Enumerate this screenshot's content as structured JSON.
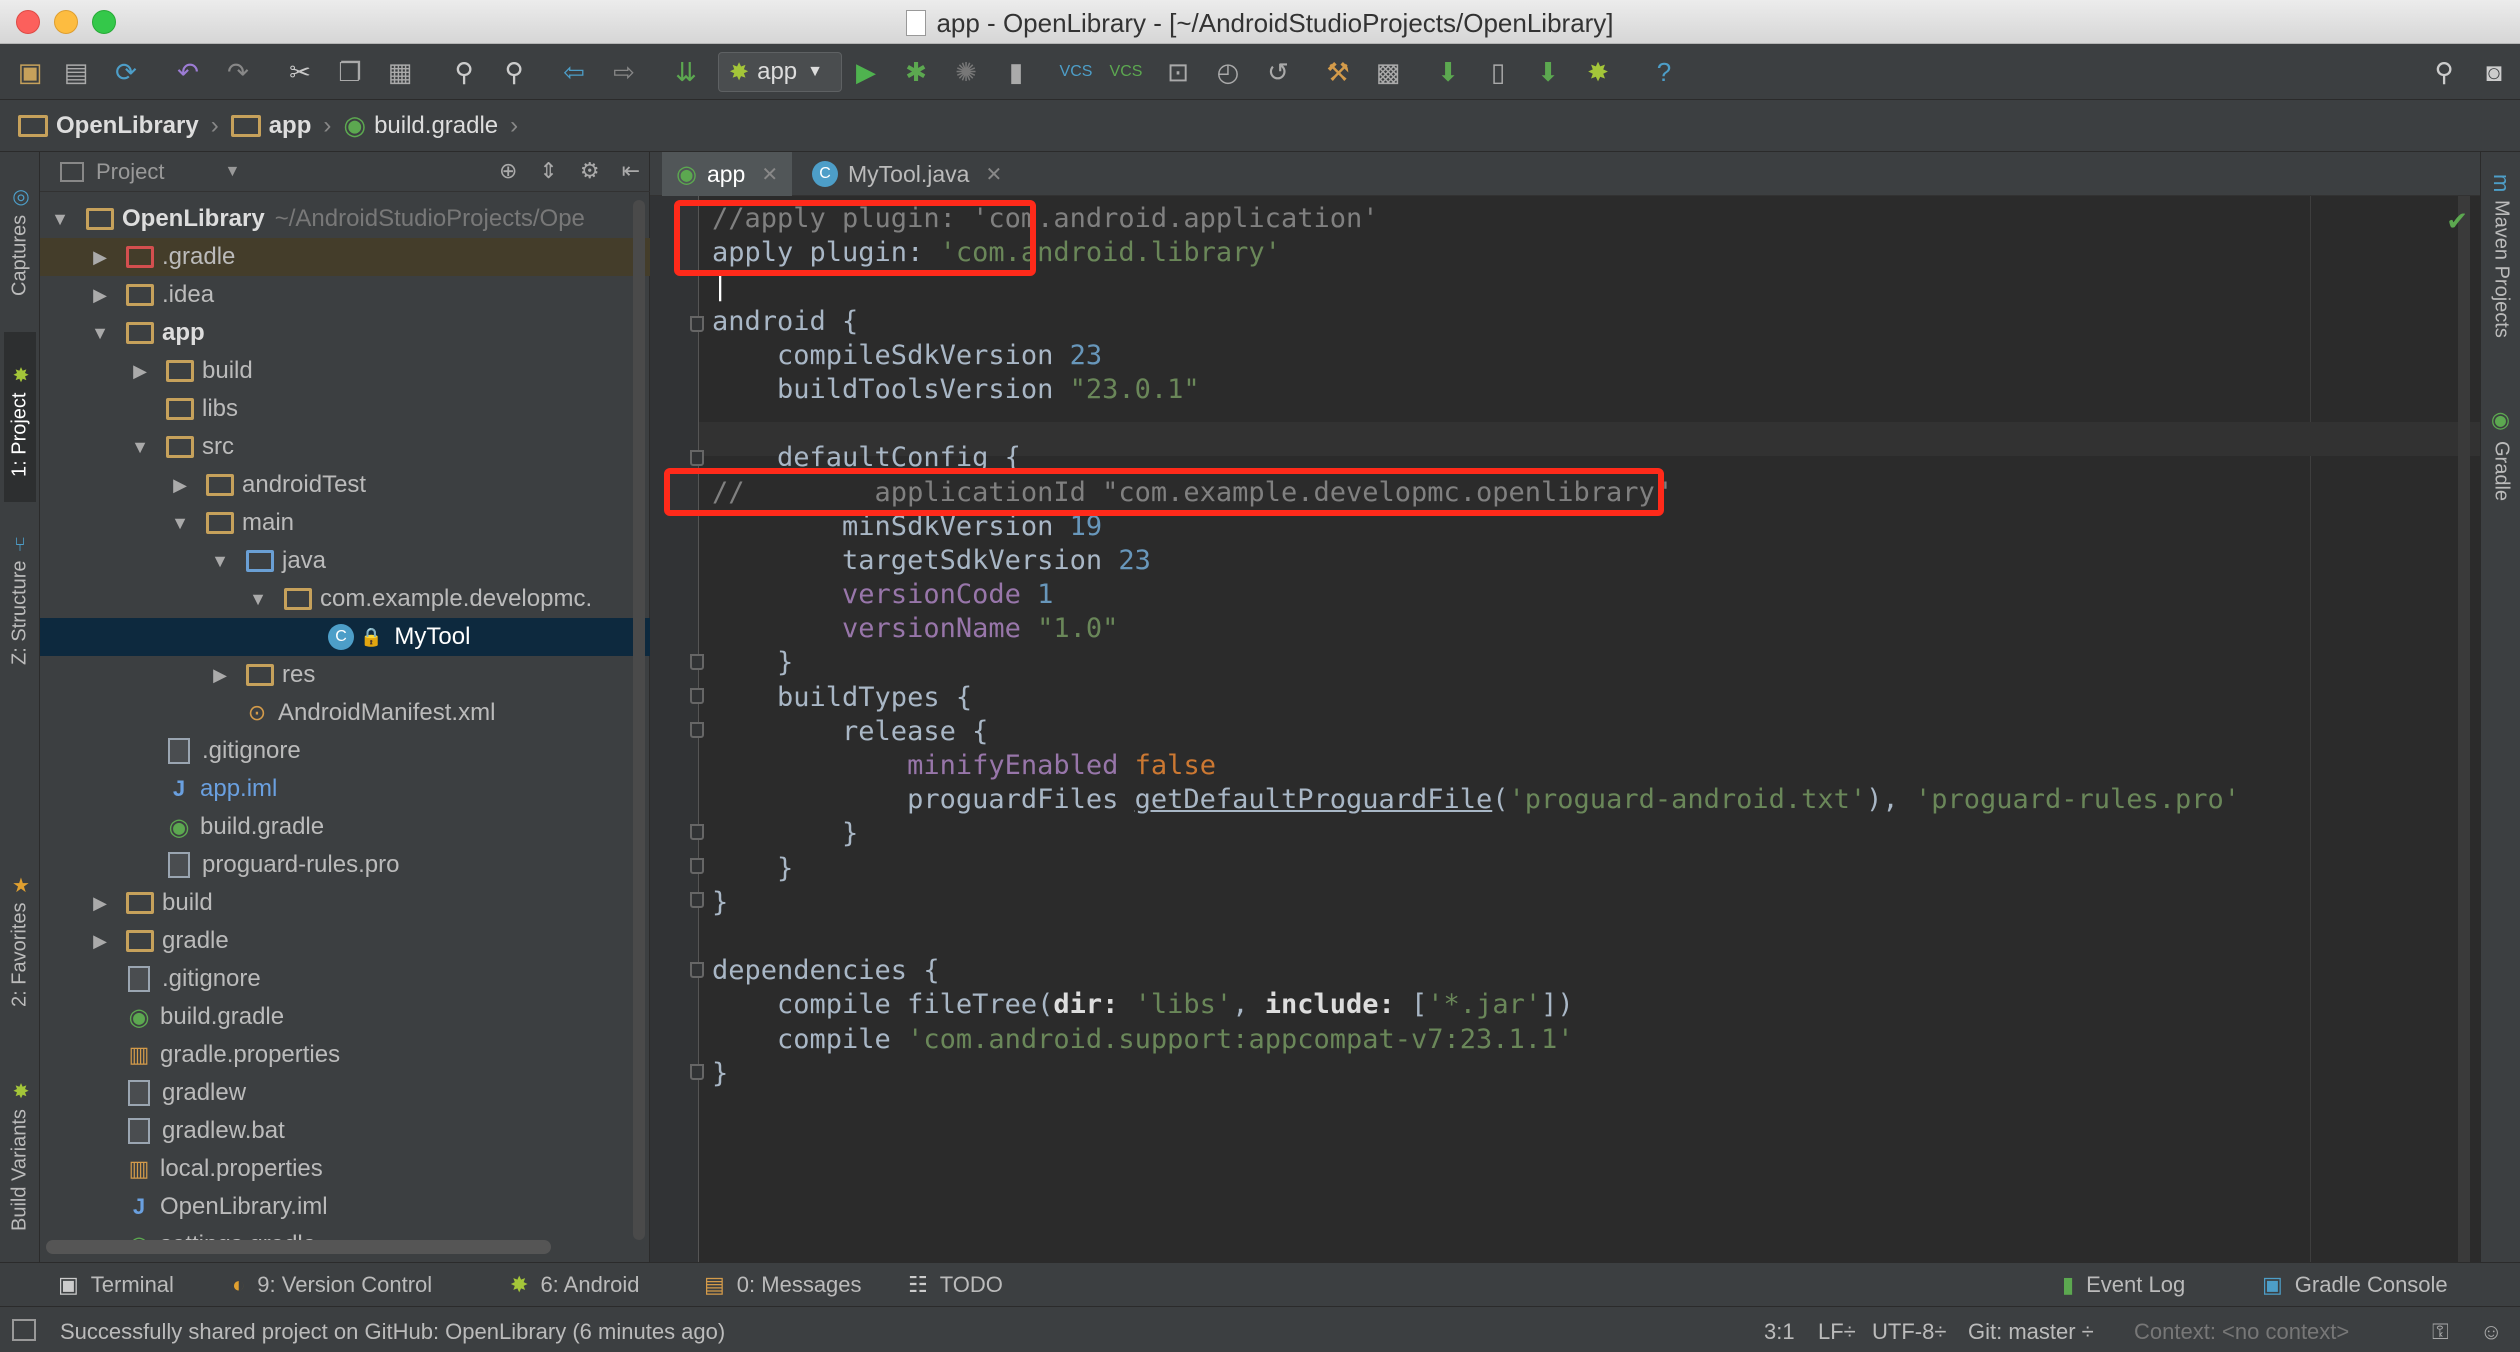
{
  "window": {
    "title": "app - OpenLibrary - [~/AndroidStudioProjects/OpenLibrary]"
  },
  "toolbar": {
    "run_config": "app"
  },
  "breadcrumb": [
    "OpenLibrary",
    "app",
    "build.gradle"
  ],
  "left_strip": [
    "1: Project",
    "Captures",
    "Z: Structure",
    "2: Favorites",
    "Build Variants"
  ],
  "right_strip": [
    "Maven Projects",
    "Gradle"
  ],
  "project_panel": {
    "header": "Project",
    "root_name": "OpenLibrary",
    "root_path": "~/AndroidStudioProjects/Ope",
    "items": [
      ".gradle",
      ".idea",
      "app",
      "build",
      "libs",
      "src",
      "androidTest",
      "main",
      "java",
      "com.example.developmc.",
      "MyTool",
      "res",
      "AndroidManifest.xml",
      ".gitignore",
      "app.iml",
      "build.gradle",
      "proguard-rules.pro",
      "build",
      "gradle",
      ".gitignore",
      "build.gradle",
      "gradle.properties",
      "gradlew",
      "gradlew.bat",
      "local.properties",
      "OpenLibrary.iml",
      "settings.gradle"
    ]
  },
  "editor": {
    "tabs": [
      "app",
      "MyTool.java"
    ],
    "code_lines": [
      [
        {
          "t": "//apply plugin: 'com.android.application'",
          "c": "cmt"
        }
      ],
      [
        {
          "t": "apply plugin: ",
          "c": ""
        },
        {
          "t": "'com.android.library'",
          "c": "str"
        }
      ],
      [
        {
          "t": "",
          "c": ""
        }
      ],
      [
        {
          "t": "android {",
          "c": ""
        }
      ],
      [
        {
          "t": "    compileSdkVersion ",
          "c": ""
        },
        {
          "t": "23",
          "c": "num"
        }
      ],
      [
        {
          "t": "    buildToolsVersion ",
          "c": ""
        },
        {
          "t": "\"23.0.1\"",
          "c": "str"
        }
      ],
      [
        {
          "t": "",
          "c": ""
        }
      ],
      [
        {
          "t": "    defaultConfig {",
          "c": ""
        }
      ],
      [
        {
          "t": "//        applicationId \"com.example.developmc.openlibrary\"",
          "c": "cmt"
        }
      ],
      [
        {
          "t": "        minSdkVersion ",
          "c": ""
        },
        {
          "t": "19",
          "c": "num"
        }
      ],
      [
        {
          "t": "        targetSdkVersion ",
          "c": ""
        },
        {
          "t": "23",
          "c": "num"
        }
      ],
      [
        {
          "t": "        ",
          "c": ""
        },
        {
          "t": "versionCode",
          "c": "prop"
        },
        {
          "t": " ",
          "c": ""
        },
        {
          "t": "1",
          "c": "num"
        }
      ],
      [
        {
          "t": "        ",
          "c": ""
        },
        {
          "t": "versionName",
          "c": "prop"
        },
        {
          "t": " ",
          "c": ""
        },
        {
          "t": "\"1.0\"",
          "c": "str"
        }
      ],
      [
        {
          "t": "    }",
          "c": ""
        }
      ],
      [
        {
          "t": "    buildTypes {",
          "c": ""
        }
      ],
      [
        {
          "t": "        release {",
          "c": ""
        }
      ],
      [
        {
          "t": "            ",
          "c": ""
        },
        {
          "t": "minifyEnabled",
          "c": "prop"
        },
        {
          "t": " ",
          "c": ""
        },
        {
          "t": "false",
          "c": "kw"
        }
      ],
      [
        {
          "t": "            proguardFiles ",
          "c": ""
        },
        {
          "t": "getDefaultProguardFile",
          "c": "und"
        },
        {
          "t": "(",
          "c": ""
        },
        {
          "t": "'proguard-android.txt'",
          "c": "str"
        },
        {
          "t": "), ",
          "c": ""
        },
        {
          "t": "'proguard-rules.pro'",
          "c": "str"
        }
      ],
      [
        {
          "t": "        }",
          "c": ""
        }
      ],
      [
        {
          "t": "    }",
          "c": ""
        }
      ],
      [
        {
          "t": "}",
          "c": ""
        }
      ],
      [
        {
          "t": "",
          "c": ""
        }
      ],
      [
        {
          "t": "dependencies {",
          "c": ""
        }
      ],
      [
        {
          "t": "    compile fileTree(",
          "c": ""
        },
        {
          "t": "dir: ",
          "c": "bold"
        },
        {
          "t": "'libs'",
          "c": "str"
        },
        {
          "t": ", ",
          "c": ""
        },
        {
          "t": "include: ",
          "c": "bold"
        },
        {
          "t": "[",
          "c": ""
        },
        {
          "t": "'*.jar'",
          "c": "str"
        },
        {
          "t": "])",
          "c": ""
        }
      ],
      [
        {
          "t": "    compile ",
          "c": ""
        },
        {
          "t": "'com.android.support:appcompat-v7:23.1.1'",
          "c": "str"
        }
      ],
      [
        {
          "t": "}",
          "c": ""
        }
      ]
    ]
  },
  "bottom_tabs": {
    "terminal": "Terminal",
    "version_control": "9: Version Control",
    "android": "6: Android",
    "messages": "0: Messages",
    "todo": "TODO",
    "event_log": "Event Log",
    "gradle_console": "Gradle Console"
  },
  "status": {
    "message": "Successfully shared project on GitHub: OpenLibrary (6 minutes ago)",
    "position": "3:1",
    "line_sep": "LF÷",
    "encoding": "UTF-8÷",
    "git": "Git: master ÷",
    "context": "Context: <no context>"
  },
  "colors": {
    "highlight_box": "#ff2a1a",
    "editor_bg": "#2b2b2b",
    "panel_bg": "#3c3f41"
  }
}
